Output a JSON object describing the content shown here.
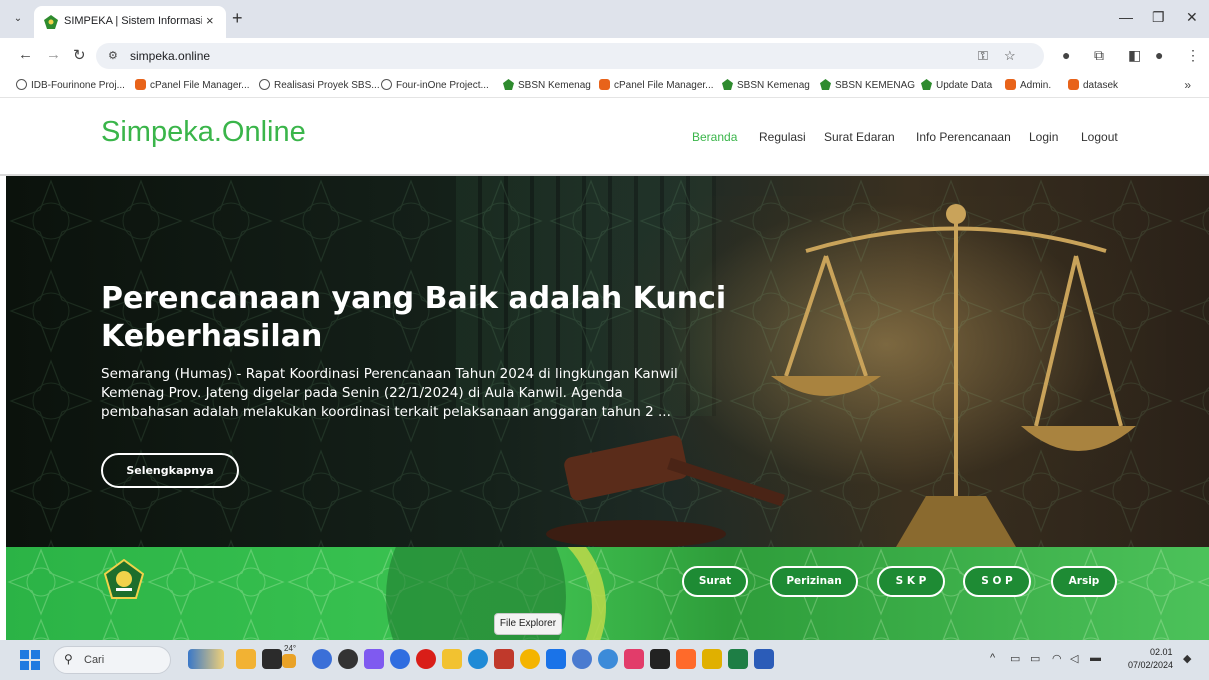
{
  "browser": {
    "tab_title": "SIMPEKA | Sistem Informasi Pe",
    "url": "simpeka.online",
    "new_tab": "+",
    "close_tab": "×"
  },
  "bookmarks": [
    {
      "label": "IDB-Fourinone Proj...",
      "icon": "globe"
    },
    {
      "label": "cPanel File Manager...",
      "icon": "cpanel"
    },
    {
      "label": "Realisasi Proyek SBS...",
      "icon": "globe"
    },
    {
      "label": "Four-inOne Project...",
      "icon": "globe"
    },
    {
      "label": "SBSN Kemenag",
      "icon": "kemenag"
    },
    {
      "label": "cPanel File Manager...",
      "icon": "cpanel"
    },
    {
      "label": "SBSN Kemenag",
      "icon": "kemenag"
    },
    {
      "label": "SBSN KEMENAG",
      "icon": "kemenag"
    },
    {
      "label": "Update Data",
      "icon": "kemenag"
    },
    {
      "label": "Admin.",
      "icon": "cpanel"
    },
    {
      "label": "datasek",
      "icon": "cpanel"
    }
  ],
  "site": {
    "logo": "Simpeka.Online",
    "nav": [
      "Beranda",
      "Regulasi",
      "Surat Edaran",
      "Info Perencanaan",
      "Login",
      "Logout"
    ]
  },
  "hero": {
    "title": "Perencanaan yang Baik adalah Kunci Keberhasilan",
    "text": "Semarang (Humas) - Rapat Koordinasi Perencanaan Tahun 2024 di lingkungan Kanwil Kemenag Prov. Jateng digelar pada Senin (22/1/2024) di Aula Kanwil. Agenda pembahasan adalah melakukan koordinasi terkait pelaksanaan anggaran tahun 2 ...",
    "button": "Selengkapnya"
  },
  "quicklinks": [
    "Surat",
    "Perizinan",
    "S K P",
    "S O P",
    "Arsip"
  ],
  "tooltip": "File Explorer",
  "taskbar": {
    "search": "Cari",
    "weather": "24°",
    "time": "02.01",
    "date": "07/02/2024"
  },
  "colors": {
    "brand_green": "#3ab54a",
    "pill_green": "#1e8b34"
  }
}
